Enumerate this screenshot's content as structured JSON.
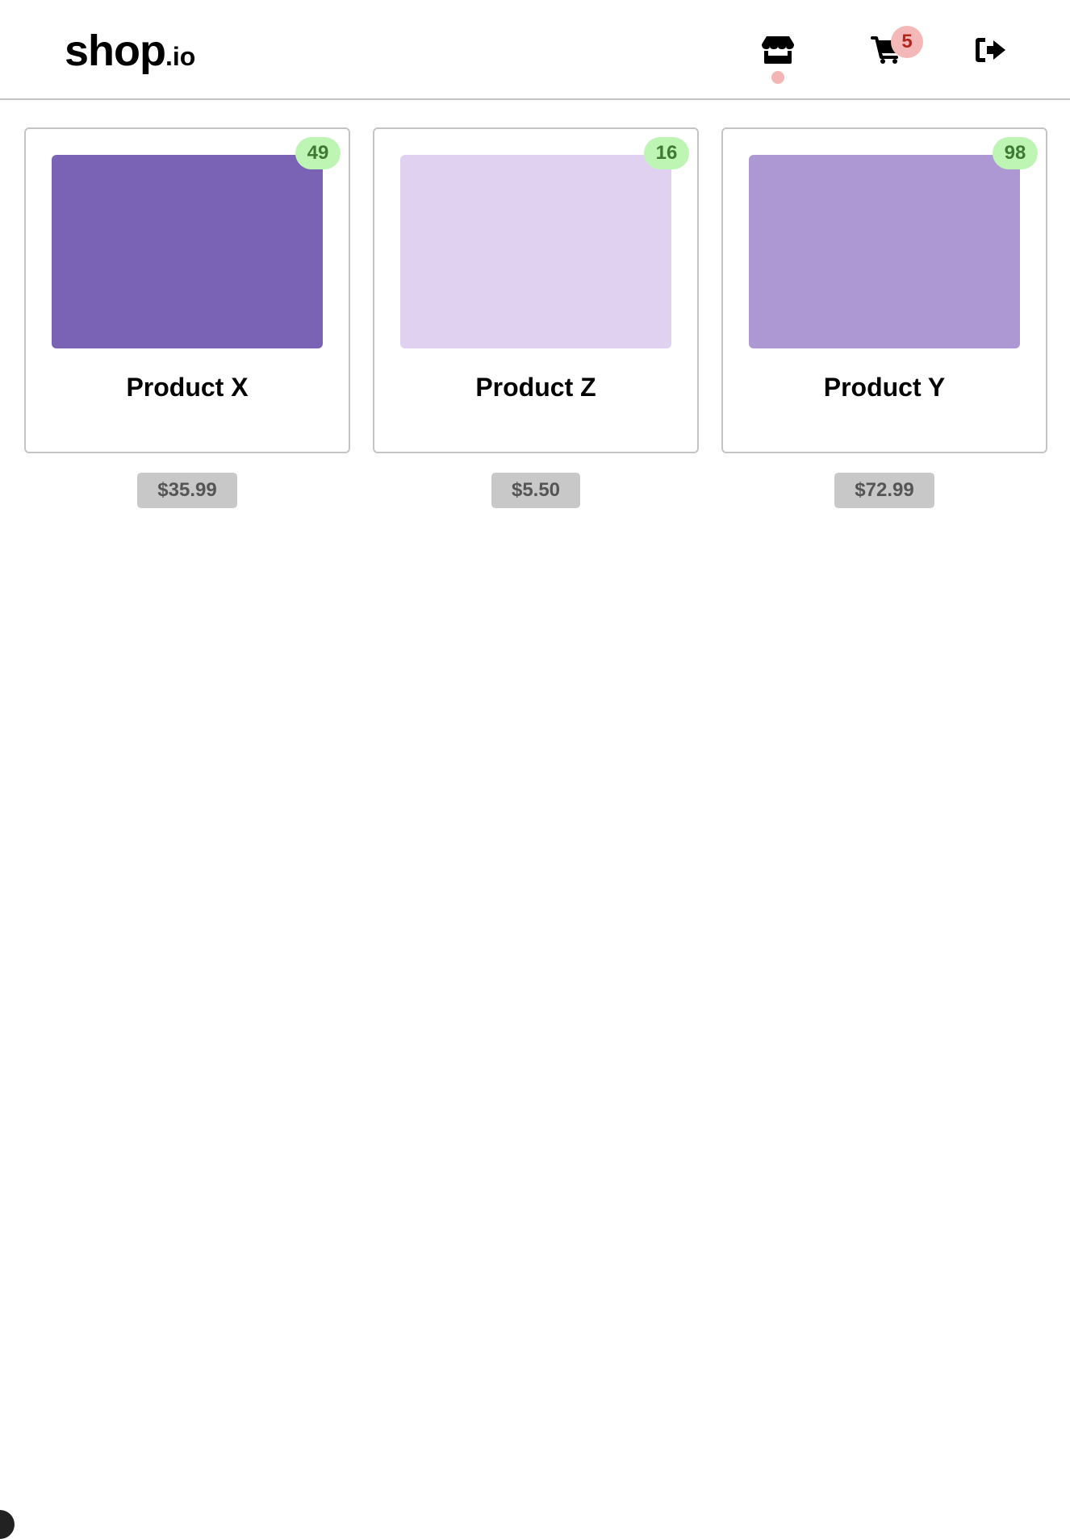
{
  "brand": {
    "name": "shop",
    "suffix": ".io"
  },
  "nav": {
    "store_icon": "store-icon",
    "cart_icon": "cart-icon",
    "logout_icon": "logout-icon",
    "active_indicator_color": "#f4b5b5",
    "cart_count": "5",
    "cart_badge_bg": "#f5b8b8",
    "cart_badge_color": "#b3261e"
  },
  "stock_badge": {
    "bg": "#bff5b4",
    "color": "#3e7a34"
  },
  "products": [
    {
      "name": "Product X",
      "stock": "49",
      "price": "$35.99",
      "color": "#7a62b5"
    },
    {
      "name": "Product Z",
      "stock": "16",
      "price": "$5.50",
      "color": "#e0d1f0"
    },
    {
      "name": "Product Y",
      "stock": "98",
      "price": "$72.99",
      "color": "#ad98d3"
    }
  ]
}
